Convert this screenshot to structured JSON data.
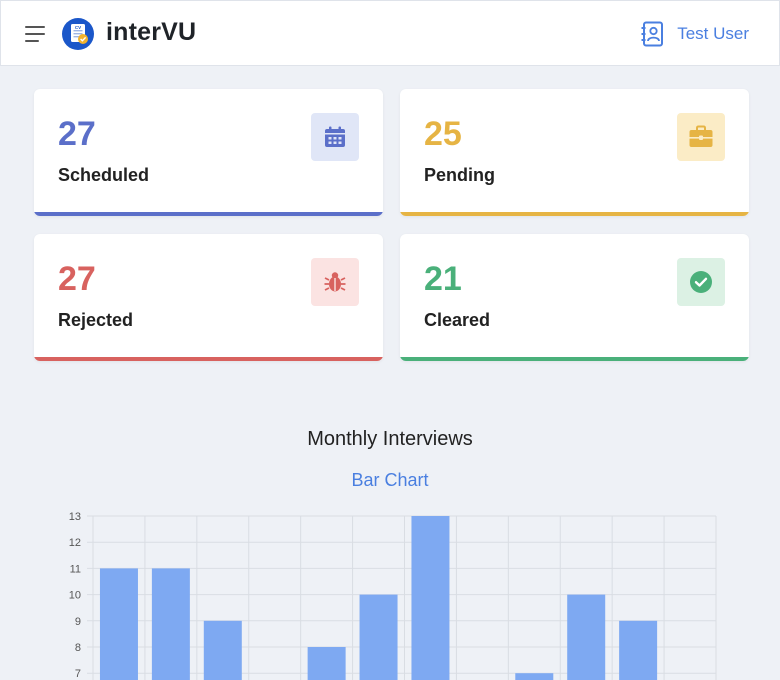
{
  "header": {
    "brand": "interVU",
    "user_name": "Test User",
    "logo_badge": "CV"
  },
  "cards": [
    {
      "label": "Scheduled",
      "count": "27",
      "color": "#5b6fc9",
      "icon_bg": "#e0e6f7",
      "icon": "calendar-icon"
    },
    {
      "label": "Pending",
      "count": "25",
      "color": "#e6b444",
      "icon_bg": "#fbecc6",
      "icon": "briefcase-icon"
    },
    {
      "label": "Rejected",
      "count": "27",
      "color": "#d8625f",
      "icon_bg": "#fbe3e2",
      "icon": "bug-icon"
    },
    {
      "label": "Cleared",
      "count": "21",
      "color": "#4ab07a",
      "icon_bg": "#dcf1e4",
      "icon": "check-circle-icon"
    }
  ],
  "chart": {
    "title": "Monthly Interviews",
    "subtitle": "Bar Chart"
  },
  "chart_data": {
    "type": "bar",
    "categories": [
      "",
      "",
      "",
      "",
      "",
      "",
      "",
      "",
      "",
      "",
      "",
      ""
    ],
    "values": [
      11,
      11,
      9,
      null,
      8,
      10,
      13,
      null,
      7,
      10,
      9,
      null
    ],
    "bar_color": "#7ea9f2",
    "grid": true,
    "y_ticks": [
      7,
      8,
      9,
      10,
      11,
      12,
      13
    ],
    "ylim_visible": [
      7,
      13
    ]
  }
}
